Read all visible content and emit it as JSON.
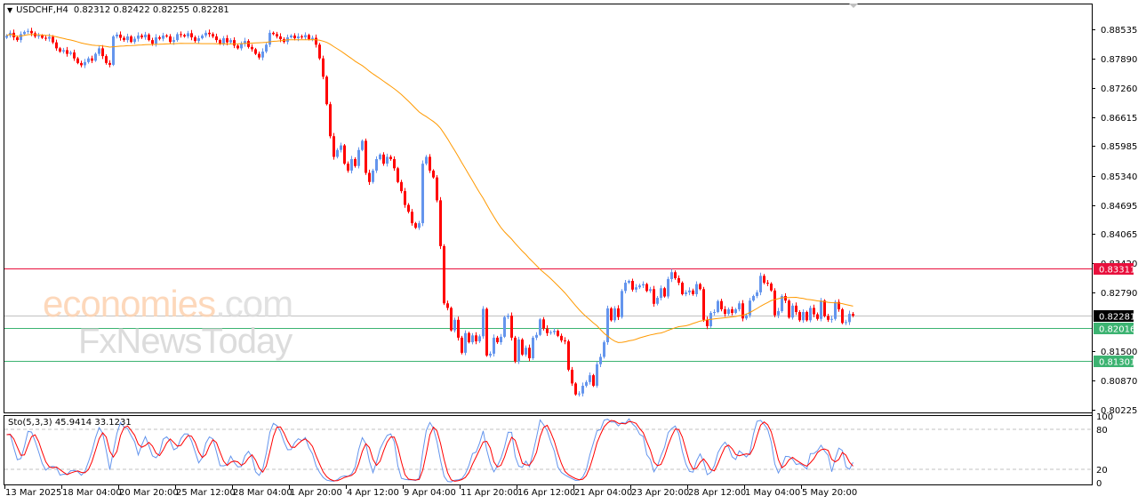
{
  "header": {
    "symbol": "USDCHF,H4",
    "ohlc": "0.82312 0.82422 0.82255 0.82281"
  },
  "indicator": {
    "label": "Sto(5,3,3) 45.9414 33.1231",
    "levels": [
      "100",
      "80",
      "20",
      "0"
    ]
  },
  "watermark": {
    "brand1": "economies",
    "brand1_suffix": ".com",
    "brand2": "FxNewsToday"
  },
  "colors": {
    "bull": "#6495ed",
    "bear": "#ff0000",
    "ma": "#ff9900",
    "resistance": "#e8103c",
    "support": "#3cb371",
    "current": "#c0c0c0",
    "stoch_main": "#6495ed",
    "stoch_signal": "#ff0000"
  },
  "chart_data": {
    "type": "candlestick",
    "symbol": "USDCHF",
    "timeframe": "H4",
    "first_open": 0.8835,
    "close": [
      0.884,
      0.8846,
      0.8836,
      0.883,
      0.8843,
      0.8848,
      0.885,
      0.8845,
      0.8838,
      0.884,
      0.8835,
      0.8833,
      0.8837,
      0.8825,
      0.8812,
      0.8805,
      0.8808,
      0.88,
      0.8803,
      0.879,
      0.878,
      0.8775,
      0.8782,
      0.879,
      0.8785,
      0.88,
      0.8812,
      0.8795,
      0.878,
      0.8776,
      0.8838,
      0.8842,
      0.8835,
      0.883,
      0.8838,
      0.8826,
      0.8833,
      0.884,
      0.8836,
      0.8842,
      0.883,
      0.8822,
      0.8836,
      0.8833,
      0.884,
      0.8838,
      0.8826,
      0.883,
      0.8843,
      0.8841,
      0.8838,
      0.8845,
      0.8836,
      0.8828,
      0.8834,
      0.884,
      0.8846,
      0.8843,
      0.8838,
      0.883,
      0.8822,
      0.8834,
      0.8825,
      0.883,
      0.8818,
      0.8812,
      0.8822,
      0.8828,
      0.8815,
      0.881,
      0.88,
      0.8792,
      0.8805,
      0.882,
      0.8846,
      0.8843,
      0.8838,
      0.8832,
      0.8826,
      0.8836,
      0.884,
      0.8834,
      0.8838,
      0.8836,
      0.8841,
      0.8832,
      0.8835,
      0.882,
      0.879,
      0.875,
      0.869,
      0.862,
      0.8575,
      0.859,
      0.86,
      0.856,
      0.8545,
      0.857,
      0.8555,
      0.859,
      0.861,
      0.854,
      0.852,
      0.8545,
      0.857,
      0.858,
      0.856,
      0.8575,
      0.857,
      0.855,
      0.852,
      0.85,
      0.847,
      0.8455,
      0.843,
      0.842,
      0.843,
      0.856,
      0.8575,
      0.8545,
      0.853,
      0.848,
      0.838,
      0.8255,
      0.8245,
      0.8196,
      0.8219,
      0.818,
      0.8147,
      0.819,
      0.817,
      0.8185,
      0.8172,
      0.8183,
      0.8243,
      0.8141,
      0.8145,
      0.818,
      0.817,
      0.8182,
      0.8225,
      0.8228,
      0.818,
      0.8128,
      0.8176,
      0.8143,
      0.8158,
      0.8135,
      0.818,
      0.8186,
      0.822,
      0.82,
      0.819,
      0.8192,
      0.8195,
      0.8184,
      0.8174,
      0.8172,
      0.811,
      0.808,
      0.8056,
      0.8058,
      0.8075,
      0.8083,
      0.8098,
      0.8075,
      0.8122,
      0.8138,
      0.817,
      0.8244,
      0.8218,
      0.8244,
      0.8225,
      0.8282,
      0.83,
      0.8304,
      0.8285,
      0.829,
      0.8294,
      0.8297,
      0.8282,
      0.8286,
      0.8254,
      0.8267,
      0.8288,
      0.827,
      0.8308,
      0.8323,
      0.831,
      0.83,
      0.8275,
      0.8279,
      0.8283,
      0.8275,
      0.8297,
      0.8286,
      0.8219,
      0.8205,
      0.8234,
      0.8236,
      0.826,
      0.8242,
      0.8232,
      0.8242,
      0.8234,
      0.8242,
      0.8255,
      0.8222,
      0.8229,
      0.8261,
      0.8271,
      0.8279,
      0.8315,
      0.83,
      0.8298,
      0.8283,
      0.8229,
      0.8238,
      0.8271,
      0.8261,
      0.8224,
      0.825,
      0.8236,
      0.8218,
      0.8236,
      0.8218,
      0.8245,
      0.8231,
      0.8221,
      0.8261,
      0.8227,
      0.8219,
      0.8221,
      0.8258,
      0.8242,
      0.8212,
      0.8214,
      0.8232,
      0.82281
    ],
    "ma_period": 50,
    "stochastic": {
      "k": 5,
      "d": 3,
      "slowing": 3,
      "main": 45.9414,
      "signal": 33.1231,
      "levels": [
        80,
        20
      ]
    },
    "price_ticks": [
      "0.88535",
      "0.87890",
      "0.87260",
      "0.86615",
      "0.85985",
      "0.85340",
      "0.84695",
      "0.84065",
      "0.83420",
      "0.82790",
      "0.81500",
      "0.80870",
      "0.80225"
    ],
    "ylim": [
      0.80225,
      0.88535
    ],
    "time_labels": [
      {
        "i": 0,
        "label": "13 Mar 2025"
      },
      {
        "i": 16,
        "label": "18 Mar 04:00"
      },
      {
        "i": 32,
        "label": "20 Mar 20:00"
      },
      {
        "i": 48,
        "label": "25 Mar 12:00"
      },
      {
        "i": 64,
        "label": "28 Mar 04:00"
      },
      {
        "i": 80,
        "label": "1 Apr 20:00"
      },
      {
        "i": 96,
        "label": "4 Apr 12:00"
      },
      {
        "i": 112,
        "label": "9 Apr 04:00"
      },
      {
        "i": 128,
        "label": "11 Apr 20:00"
      },
      {
        "i": 144,
        "label": "16 Apr 12:00"
      },
      {
        "i": 160,
        "label": "21 Apr 04:00"
      },
      {
        "i": 176,
        "label": "23 Apr 20:00"
      },
      {
        "i": 192,
        "label": "28 Apr 12:00"
      },
      {
        "i": 208,
        "label": "1 May 04:00"
      },
      {
        "i": 224,
        "label": "5 May 20:00"
      }
    ],
    "hlines": [
      {
        "price": 0.83311,
        "label": "0.83311",
        "kind": "resistance"
      },
      {
        "price": 0.82281,
        "label": "0.82281",
        "kind": "current"
      },
      {
        "price": 0.82016,
        "label": "0.82016",
        "kind": "support"
      },
      {
        "price": 0.81301,
        "label": "0.81301",
        "kind": "support"
      }
    ]
  }
}
